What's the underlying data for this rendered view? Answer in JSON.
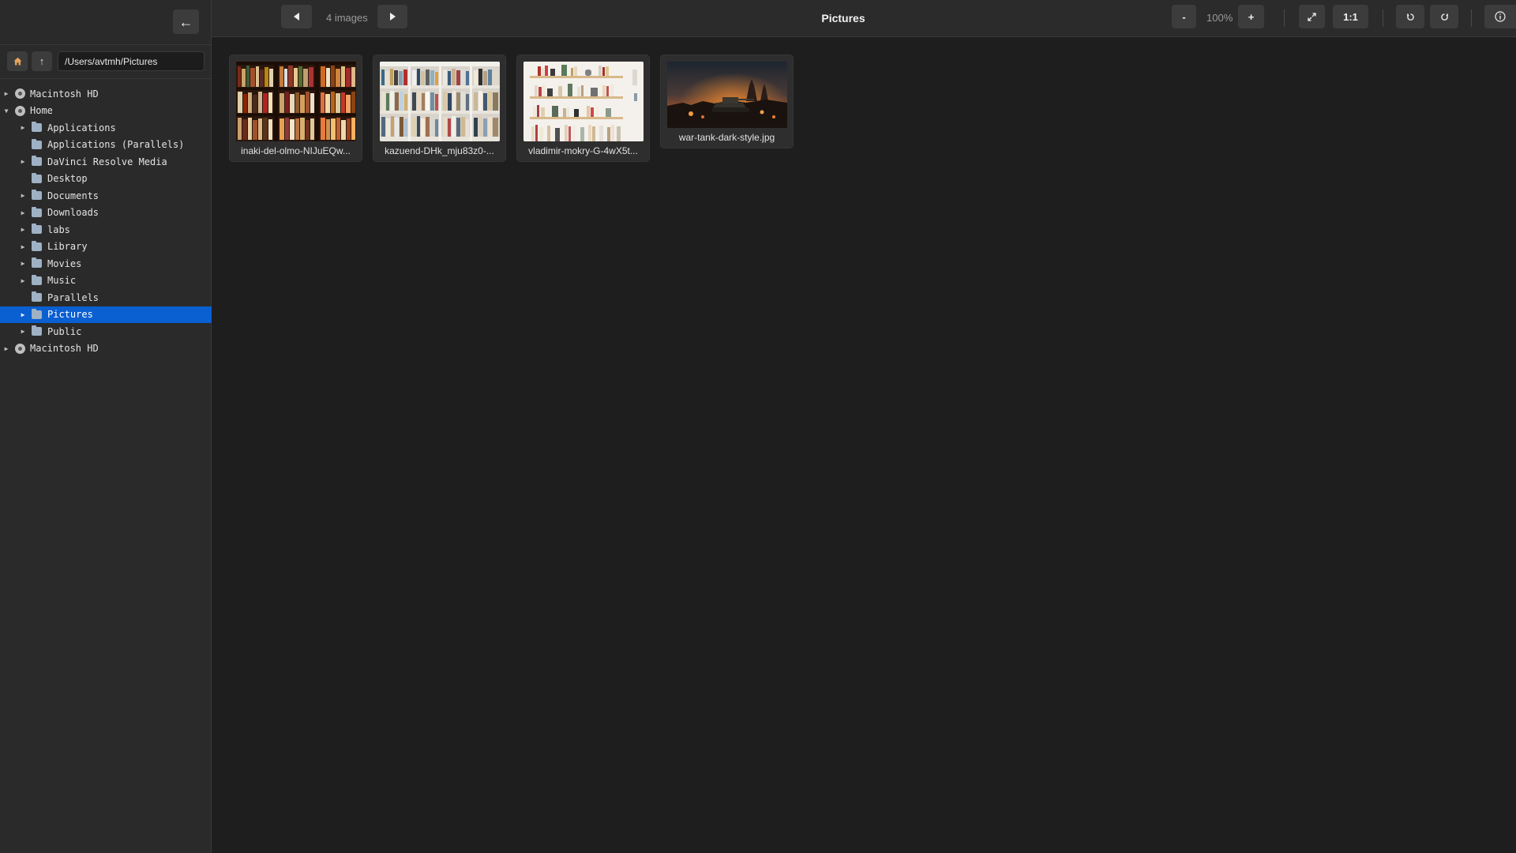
{
  "window": {
    "title": "Pictures"
  },
  "sidebar": {
    "collapse_icon": "arrow-left-icon",
    "home_icon": "home-icon",
    "up_icon": "arrow-up-icon",
    "path": "/Users/avtmh/Pictures",
    "tree": [
      {
        "label": "Macintosh HD",
        "icon": "drive-icon",
        "expanded": false,
        "has_children": true,
        "level": 0
      },
      {
        "label": "Home",
        "icon": "drive-icon",
        "expanded": true,
        "has_children": true,
        "level": 0
      },
      {
        "label": "Applications",
        "icon": "folder-icon",
        "expanded": false,
        "has_children": true,
        "level": 1
      },
      {
        "label": "Applications (Parallels)",
        "icon": "folder-icon",
        "expanded": false,
        "has_children": false,
        "level": 1
      },
      {
        "label": "DaVinci Resolve Media",
        "icon": "folder-icon",
        "expanded": false,
        "has_children": true,
        "level": 1
      },
      {
        "label": "Desktop",
        "icon": "folder-icon",
        "expanded": false,
        "has_children": false,
        "level": 1
      },
      {
        "label": "Documents",
        "icon": "folder-icon",
        "expanded": false,
        "has_children": true,
        "level": 1
      },
      {
        "label": "Downloads",
        "icon": "folder-icon",
        "expanded": false,
        "has_children": true,
        "level": 1
      },
      {
        "label": "labs",
        "icon": "folder-icon",
        "expanded": false,
        "has_children": true,
        "level": 1
      },
      {
        "label": "Library",
        "icon": "folder-icon",
        "expanded": false,
        "has_children": true,
        "level": 1
      },
      {
        "label": "Movies",
        "icon": "folder-icon",
        "expanded": false,
        "has_children": true,
        "level": 1
      },
      {
        "label": "Music",
        "icon": "folder-icon",
        "expanded": false,
        "has_children": true,
        "level": 1
      },
      {
        "label": "Parallels",
        "icon": "folder-icon",
        "expanded": false,
        "has_children": false,
        "level": 1
      },
      {
        "label": "Pictures",
        "icon": "folder-icon",
        "expanded": false,
        "has_children": true,
        "level": 1,
        "selected": true
      },
      {
        "label": "Public",
        "icon": "folder-icon",
        "expanded": false,
        "has_children": true,
        "level": 1
      },
      {
        "label": "Macintosh HD",
        "icon": "drive-icon",
        "expanded": false,
        "has_children": true,
        "level": 0
      }
    ]
  },
  "toolbar": {
    "prev_icon": "triangle-left-icon",
    "next_icon": "triangle-right-icon",
    "image_count": "4 images",
    "zoom_out_label": "-",
    "zoom_level": "100%",
    "zoom_in_label": "+",
    "fit_icon": "expand-icon",
    "actual_size_label": "1:1",
    "rotate_left_icon": "rotate-ccw-icon",
    "rotate_right_icon": "rotate-cw-icon",
    "info_icon": "info-icon"
  },
  "images": [
    {
      "name": "inaki-del-olmo-NIJuEQw...",
      "subject": "dark wooden bookshelf"
    },
    {
      "name": "kazuend-DHk_mju83z0-...",
      "subject": "library bookshelves"
    },
    {
      "name": "vladimir-mokry-G-4wX5t...",
      "subject": "white wall shelves"
    },
    {
      "name": "war-tank-dark-style.jpg",
      "subject": "tank in burning city"
    }
  ],
  "colors": {
    "selection": "#0a5fd1",
    "background": "#1e1e1e",
    "sidebar": "#2a2a2a"
  }
}
